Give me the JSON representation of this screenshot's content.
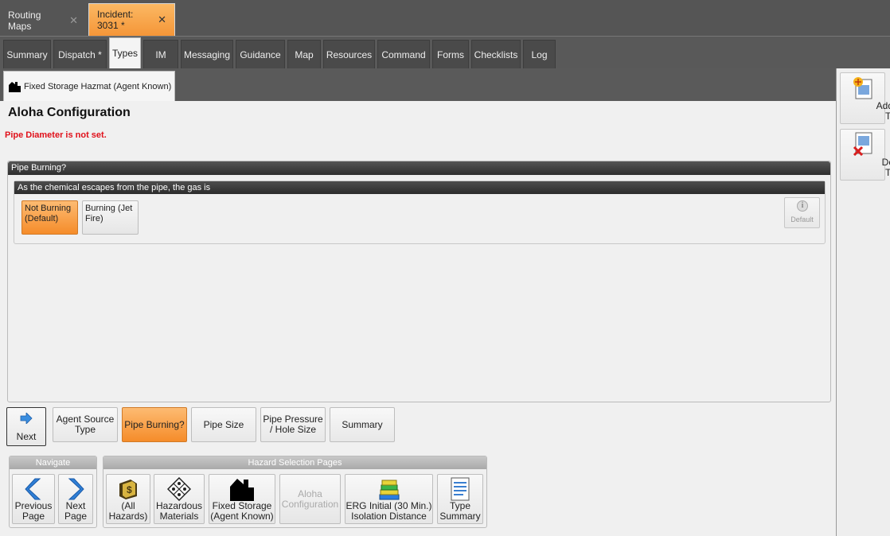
{
  "doc_tabs": [
    {
      "label": "Routing Maps",
      "close": "✕"
    },
    {
      "label": "Incident: 3031 *",
      "close": "✕"
    }
  ],
  "module_tabs": [
    "Summary",
    "Dispatch *",
    "Types",
    "IM",
    "Messaging",
    "Guidance",
    "Map",
    "Resources",
    "Command",
    "Forms",
    "Checklists",
    "Log"
  ],
  "sub_tab": {
    "label": "Fixed Storage Hazmat (Agent Known)",
    "icon": "house-icon"
  },
  "main": {
    "title": "Aloha Configuration",
    "error": "Pipe Diameter is not set.",
    "group_title": "Pipe Burning?",
    "question": "As the chemical escapes from the pipe, the gas is",
    "options": [
      {
        "label": "Not Burning (Default)",
        "selected": true
      },
      {
        "label": "Burning (Jet Fire)",
        "selected": false
      }
    ],
    "default_label": "Default"
  },
  "steps": {
    "next_label": "Next",
    "items": [
      "Agent Source Type",
      "Pipe Burning?",
      "Pipe Size",
      "Pipe Pressure / Hole Size",
      "Summary"
    ],
    "selected_index": 1
  },
  "navigate": {
    "title": "Navigate",
    "previous": "Previous Page",
    "next": "Next Page"
  },
  "hazard_pages": {
    "title": "Hazard Selection Pages",
    "items": [
      "(All Hazards)",
      "Hazardous Materials",
      "Fixed Storage (Agent Known)",
      "Aloha Configuration",
      "ERG Initial (30 Min.) Isolation Distance",
      "Type Summary"
    ]
  },
  "side": {
    "add": "Add New Type",
    "delete": "Delete Type"
  },
  "colors": {
    "accent_orange": "#f59638",
    "error_red": "#e0101a"
  }
}
